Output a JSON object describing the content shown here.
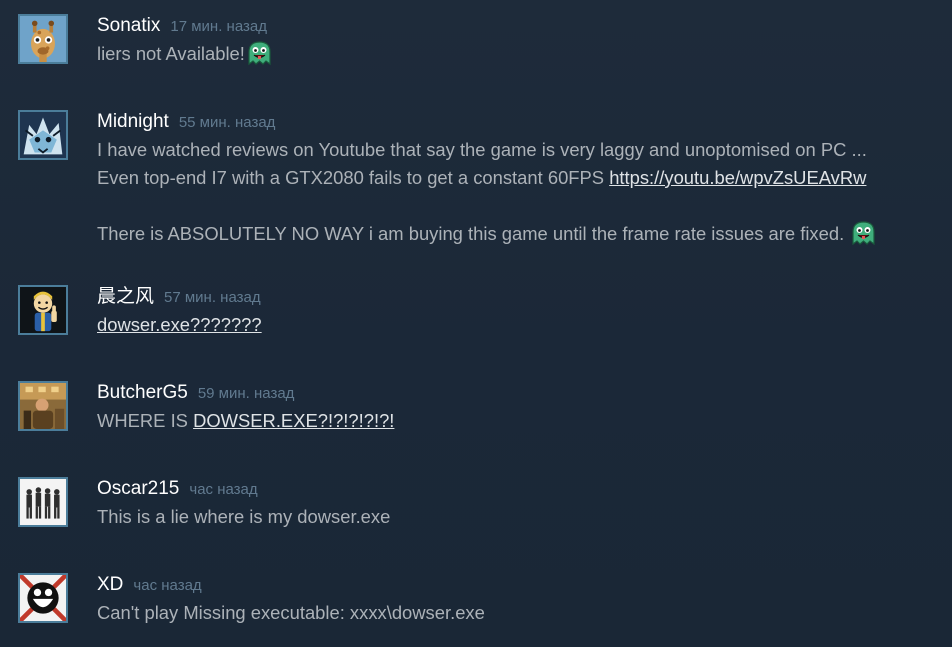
{
  "comments": [
    {
      "author": "Sonatix",
      "time": "17 мин. назад",
      "avatar_icon": "giraffe-avatar-icon",
      "lines": [
        {
          "text": "liers not Available!",
          "emote": "green-ghost-emote-icon"
        }
      ]
    },
    {
      "author": "Midnight",
      "time": "55 мин. назад",
      "avatar_icon": "wolf-avatar-icon",
      "lines": [
        {
          "text": "I have watched reviews on Youtube that say the game is very laggy and unoptomised on PC ..."
        },
        {
          "text": "Even top-end I7 with a GTX2080 fails to get a constant 60FPS ",
          "link": "https://youtu.be/wpvZsUEAvRw"
        },
        {
          "text": "There is ABSOLUTELY NO WAY i am buying this game until the frame rate issues are fixed.",
          "emote": "green-ghost-emote-icon"
        }
      ]
    },
    {
      "author": "晨之风",
      "time": "57 мин. назад",
      "avatar_icon": "vault-boy-avatar-icon",
      "lines": [
        {
          "text": "",
          "link": "dowser.exe???????"
        }
      ]
    },
    {
      "author": "ButcherG5",
      "time": "59 мин. назад",
      "avatar_icon": "soldiers-avatar-icon",
      "lines": [
        {
          "text": "WHERE IS ",
          "link": "DOWSER.EXE?!?!?!?!?!"
        }
      ]
    },
    {
      "author": "Oscar215",
      "time": "час назад",
      "avatar_icon": "squad-avatar-icon",
      "lines": [
        {
          "text": "This is a lie where is my dowser.exe"
        }
      ]
    },
    {
      "author": "XD",
      "time": "час назад",
      "avatar_icon": "smiley-avatar-icon",
      "lines": [
        {
          "text": "Can't play Missing executable: xxxx\\dowser.exe"
        }
      ]
    }
  ]
}
